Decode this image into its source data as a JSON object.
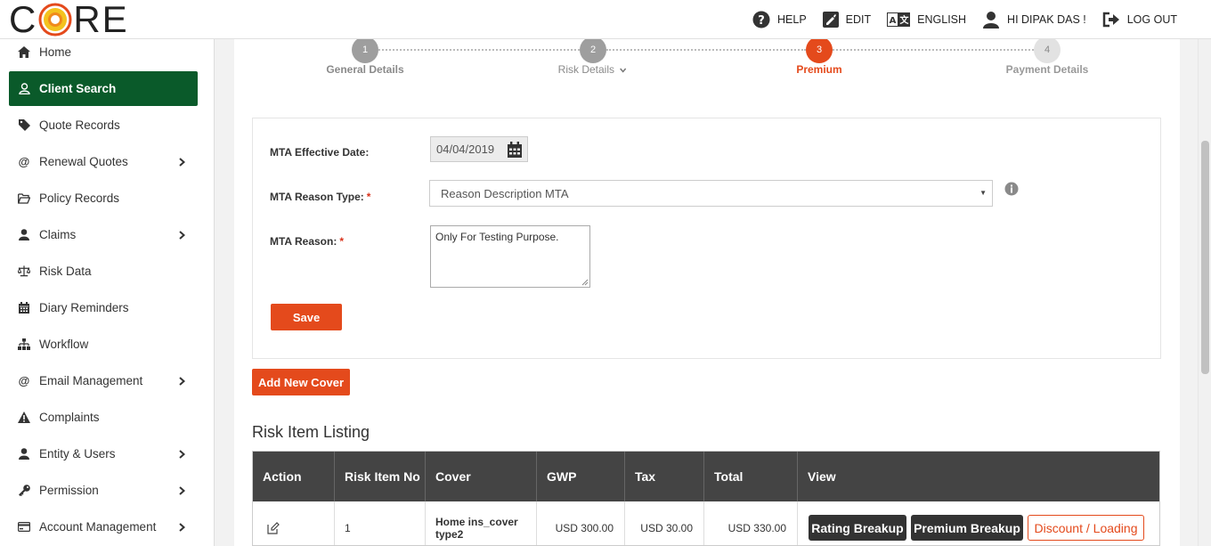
{
  "app": {
    "logo_text_before": "C",
    "logo_text_after": "RE",
    "logo_alt": "CORE"
  },
  "topnav": {
    "help": "HELP",
    "edit": "EDIT",
    "language": "ENGLISH",
    "greeting": "HI DIPAK DAS !",
    "logout": "LOG OUT"
  },
  "sidebar": {
    "items": [
      {
        "label": "Home",
        "icon": "home-icon",
        "has_submenu": false
      },
      {
        "label": "Client Search",
        "icon": "user-outline-icon",
        "has_submenu": false,
        "active": true
      },
      {
        "label": "Quote Records",
        "icon": "tag-icon",
        "has_submenu": false
      },
      {
        "label": "Renewal Quotes",
        "icon": "at-icon",
        "has_submenu": true
      },
      {
        "label": "Policy Records",
        "icon": "folder-open-icon",
        "has_submenu": false
      },
      {
        "label": "Claims",
        "icon": "user-icon",
        "has_submenu": true
      },
      {
        "label": "Risk Data",
        "icon": "balance-scale-icon",
        "has_submenu": false
      },
      {
        "label": "Diary Reminders",
        "icon": "calendar-icon",
        "has_submenu": false
      },
      {
        "label": "Workflow",
        "icon": "sitemap-icon",
        "has_submenu": false
      },
      {
        "label": "Email Management",
        "icon": "at-icon",
        "has_submenu": true
      },
      {
        "label": "Complaints",
        "icon": "warning-icon",
        "has_submenu": false
      },
      {
        "label": "Entity & Users",
        "icon": "user-icon",
        "has_submenu": true
      },
      {
        "label": "Permission",
        "icon": "key-icon",
        "has_submenu": true
      },
      {
        "label": "Account Management",
        "icon": "credit-card-icon",
        "has_submenu": true
      }
    ],
    "colors": {
      "active_bg": "#0a5a2a"
    }
  },
  "stepper": {
    "steps": [
      {
        "number": "1",
        "label": "General Details",
        "state": "done"
      },
      {
        "number": "2",
        "label": "Risk Details",
        "state": "done",
        "has_dropdown": true
      },
      {
        "number": "3",
        "label": "Premium",
        "state": "active"
      },
      {
        "number": "4",
        "label": "Payment Details",
        "state": "pending"
      }
    ],
    "colors": {
      "done": "#9e9e9e",
      "active": "#e44a1c",
      "pending": "#e0e0e0"
    }
  },
  "form": {
    "effective_date_label": "MTA Effective Date:",
    "effective_date_value": "04/04/2019",
    "reason_type_label": "MTA Reason Type:",
    "reason_type_value": "Reason Description MTA",
    "reason_label": "MTA Reason:",
    "reason_value": "Only For Testing Purpose.",
    "required_mark": "*",
    "save_label": "Save"
  },
  "add_cover_label": "Add New Cover",
  "risk_listing": {
    "title": "Risk Item Listing",
    "columns": [
      "Action",
      "Risk Item No",
      "Cover",
      "GWP",
      "Tax",
      "Total",
      "View"
    ],
    "rows": [
      {
        "risk_item_no": "1",
        "cover": "Home ins_cover type2",
        "gwp": "USD  300.00",
        "tax": "USD  30.00",
        "total": "USD  330.00",
        "view_buttons": [
          "Rating Breakup",
          "Premium Breakup",
          "Discount / Loading"
        ]
      }
    ]
  },
  "colors": {
    "accent": "#e44a1c",
    "table_header": "#444444"
  }
}
